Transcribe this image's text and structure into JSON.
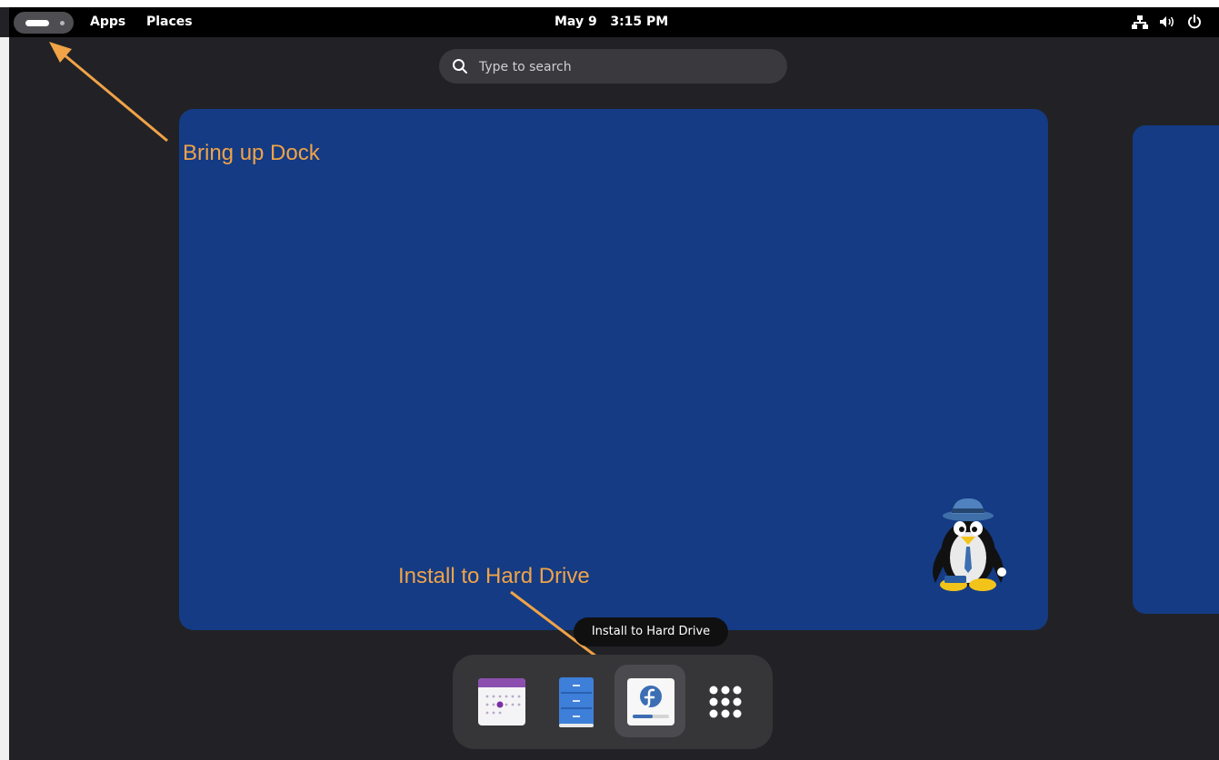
{
  "topbar": {
    "apps_label": "Apps",
    "places_label": "Places",
    "date": "May 9",
    "time": "3:15 PM"
  },
  "search": {
    "placeholder": "Type to search"
  },
  "annotations": {
    "dock_label": "Bring up Dock",
    "install_label": "Install to Hard Drive",
    "color": "#f0a347"
  },
  "tooltip": {
    "text": "Install to Hard Drive"
  },
  "dock": {
    "items": [
      {
        "name": "Calendar",
        "icon": "calendar-icon"
      },
      {
        "name": "Files",
        "icon": "file-cabinet-icon"
      },
      {
        "name": "Install to Hard Drive",
        "icon": "fedora-installer-icon",
        "active": true
      },
      {
        "name": "Show Apps",
        "icon": "app-grid-icon"
      }
    ]
  },
  "colors": {
    "workspace": "#143b84",
    "panel": "#000000",
    "dock": "#363639"
  }
}
